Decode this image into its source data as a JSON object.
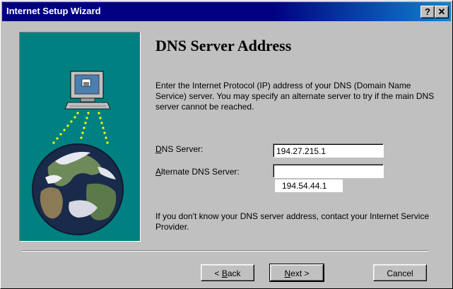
{
  "window": {
    "title": "Internet Setup Wizard"
  },
  "titlebar_buttons": {
    "help": "?",
    "close": "✕"
  },
  "page": {
    "heading": "DNS Server Address",
    "description": "Enter the Internet Protocol (IP) address of your DNS (Domain Name Service) server.  You may specify an alternate server to try if the main DNS server cannot be reached.",
    "footer_note": "If you don't know your DNS server address, contact your Internet Service Provider."
  },
  "fields": {
    "dns_server": {
      "label_mnemonic": "D",
      "label_rest": "NS Server:",
      "value": "194.27.215.1"
    },
    "alternate_dns": {
      "label_mnemonic": "A",
      "label_rest": "lternate DNS Server:",
      "value": ""
    },
    "suggestion": "194.54.44.1"
  },
  "buttons": {
    "back": {
      "prefix": "< ",
      "mnemonic": "B",
      "rest": "ack"
    },
    "next": {
      "mnemonic": "N",
      "rest": "ext >"
    },
    "cancel": "Cancel"
  },
  "colors": {
    "titlebar": "#000080",
    "art_background": "#008080",
    "face": "#c0c0c0"
  },
  "icons": [
    "computer-icon",
    "globe-icon",
    "help-icon",
    "close-icon"
  ]
}
